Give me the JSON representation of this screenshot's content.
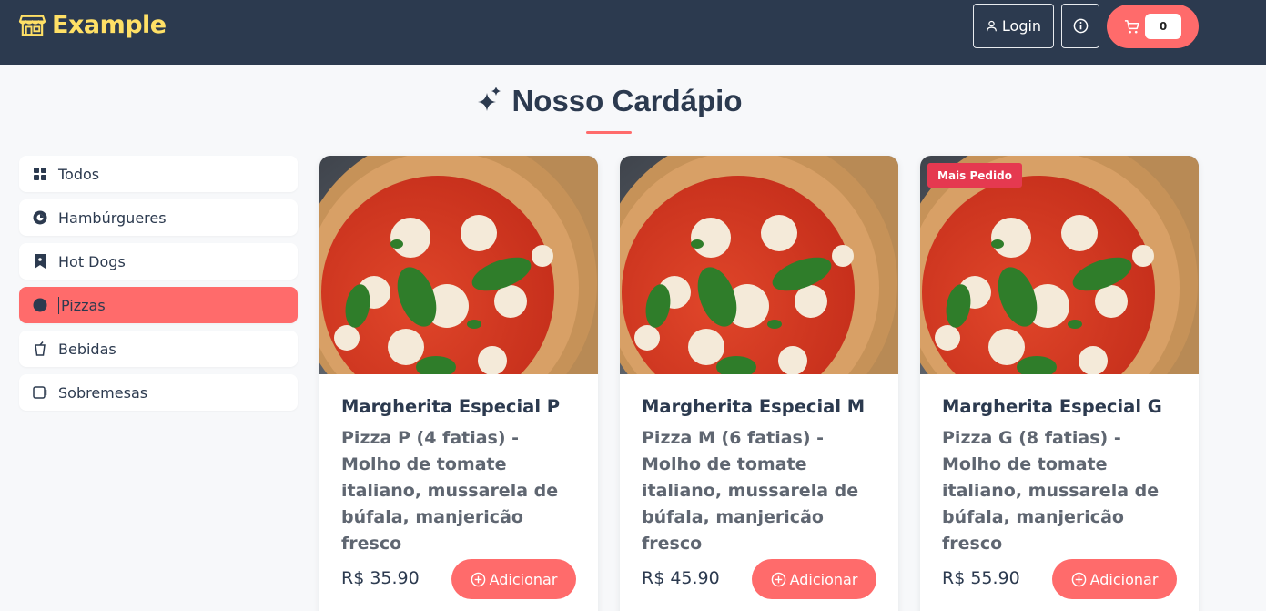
{
  "header": {
    "brand": "Example",
    "login_label": "Login",
    "cart_count": "0",
    "colors": {
      "bg": "#2c3a4f",
      "brand": "#ffe066",
      "accent": "#ff6b6b"
    }
  },
  "menu": {
    "title": "Nosso Cardápio"
  },
  "sidebar": {
    "items": [
      {
        "label": "Todos",
        "icon": "grid-icon",
        "active": false
      },
      {
        "label": "Hambúrgueres",
        "icon": "burger-icon",
        "active": false
      },
      {
        "label": "Hot Dogs",
        "icon": "bookmark-icon",
        "active": false
      },
      {
        "label": "Pizzas",
        "icon": "circle-icon",
        "active": true
      },
      {
        "label": "Bebidas",
        "icon": "cup-icon",
        "active": false
      },
      {
        "label": "Sobremesas",
        "icon": "dessert-icon",
        "active": false
      }
    ]
  },
  "products": [
    {
      "name": "Margherita Especial P",
      "description": "Pizza P (4 fatias) - Molho de tomate italiano, mussarela de búfala, manjericão fresco",
      "price": "R$ 35.90",
      "add_label": "Adicionar"
    },
    {
      "name": "Margherita Especial M",
      "description": "Pizza M (6 fatias) - Molho de tomate italiano, mussarela de búfala, manjericão fresco",
      "price": "R$ 45.90",
      "add_label": "Adicionar"
    },
    {
      "name": "Margherita Especial G",
      "description": "Pizza G (8 fatias) - Molho de tomate italiano, mussarela de búfala, manjericão fresco",
      "price": "R$ 55.90",
      "add_label": "Adicionar",
      "badge": "Mais Pedido"
    }
  ]
}
